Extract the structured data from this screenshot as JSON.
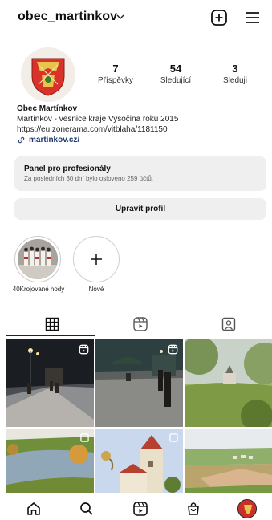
{
  "header": {
    "username": "obec_martinkov"
  },
  "stats": [
    {
      "value": "7",
      "label": "Příspěvky"
    },
    {
      "value": "54",
      "label": "Sledující"
    },
    {
      "value": "3",
      "label": "Sleduji"
    }
  ],
  "bio": {
    "name": "Obec Martínkov",
    "description": "Martínkov - vesnice kraje Vysočina roku 2015",
    "url": "https://eu.zonerama.com/vitblaha/1181150",
    "link": "martinkov.cz/"
  },
  "pro_panel": {
    "title": "Panel pro profesionály",
    "subtitle": "Za posledních 30 dní bylo osloveno 259 účtů."
  },
  "edit_profile_label": "Upravit profil",
  "highlights": [
    {
      "label": "40Krojované hody"
    },
    {
      "label": "Nové"
    }
  ],
  "tabs": [
    {
      "icon": "grid-icon",
      "active": true
    },
    {
      "icon": "reels-icon",
      "active": false
    },
    {
      "icon": "tagged-icon",
      "active": false
    }
  ],
  "posts": [
    {
      "type": "reel",
      "scene": "night-street"
    },
    {
      "type": "reel",
      "scene": "night-square"
    },
    {
      "type": "photo",
      "scene": "church-through-leaves"
    },
    {
      "type": "multi",
      "scene": "pond-landscape"
    },
    {
      "type": "multi",
      "scene": "church-tower"
    },
    {
      "type": "photo",
      "scene": "aerial-fields"
    }
  ],
  "colors": {
    "accent": "#c9302c",
    "link": "#1f3a6e",
    "panel": "#efefef"
  }
}
